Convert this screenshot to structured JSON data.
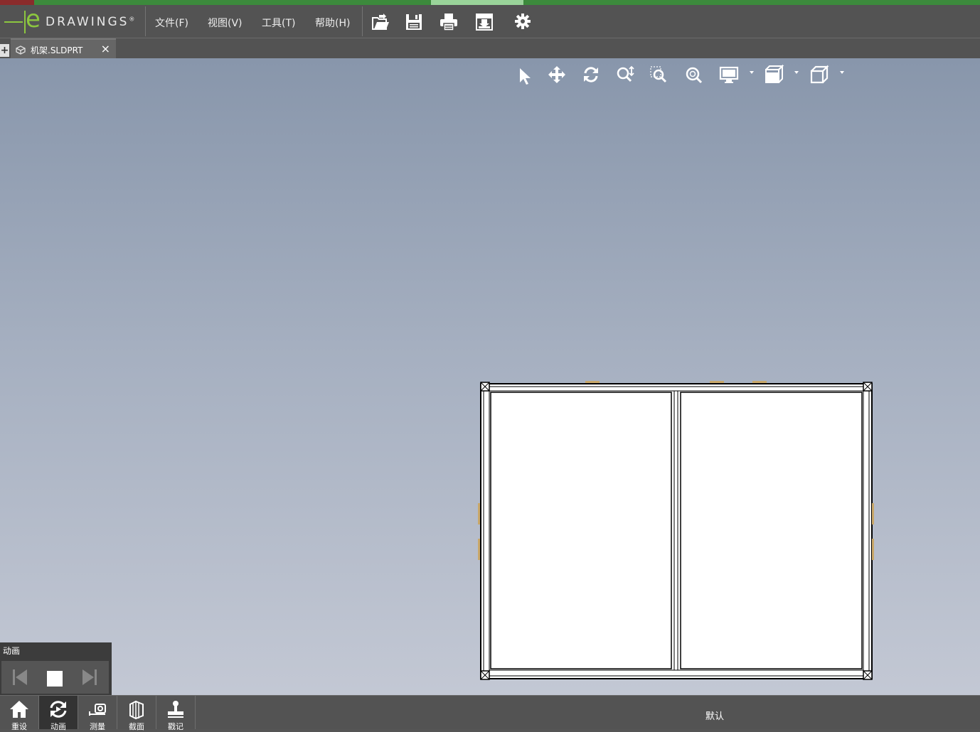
{
  "app": {
    "logo_text": "DRAWINGS",
    "logo_e": "e",
    "logo_mark": "®"
  },
  "menu": {
    "file": "文件(F)",
    "view": "视图(V)",
    "tools": "工具(T)",
    "help": "帮助(H)"
  },
  "toolbar_icons": [
    "open-icon",
    "save-icon",
    "print-icon",
    "publish-icon",
    "settings-icon"
  ],
  "tab": {
    "label": "机架.SLDPRT",
    "close": "×",
    "new_tab": "+"
  },
  "view_tools": [
    "select-icon",
    "pan-icon",
    "rotate-icon",
    "zoom-icon",
    "zoom-to-area-icon",
    "zoom-to-fit-icon",
    "display-style-icon",
    "view-settings-icon",
    "standard-views-icon"
  ],
  "animation_panel": {
    "title": "动画"
  },
  "bottom_buttons": [
    {
      "label": "重设",
      "icon": "home-icon"
    },
    {
      "label": "动画",
      "icon": "animate-icon"
    },
    {
      "label": "测量",
      "icon": "measure-icon"
    },
    {
      "label": "截面",
      "icon": "section-icon"
    },
    {
      "label": "戳记",
      "icon": "stamp-icon"
    }
  ],
  "status": {
    "configuration": "默认"
  },
  "colors": {
    "accent": "#8cc63f",
    "chrome": "#535353",
    "viewport_top": "#8896ab",
    "viewport_bottom": "#c3c8d4"
  }
}
